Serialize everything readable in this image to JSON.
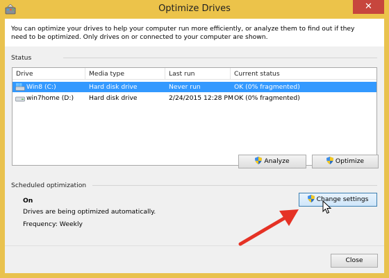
{
  "window": {
    "title": "Optimize Drives",
    "close_glyph": "✕"
  },
  "intro": {
    "text": "You can optimize your drives to help your computer run more efficiently, or analyze them to find out if they need to be optimized. Only drives on or connected to your computer are shown."
  },
  "status": {
    "label": "Status",
    "columns": [
      "Drive",
      "Media type",
      "Last run",
      "Current status"
    ],
    "rows": [
      {
        "drive": "Win8 (C:)",
        "media": "Hard disk drive",
        "last_run": "Never run",
        "status": "OK (0% fragmented)",
        "icon": "windows-drive-icon",
        "selected": true
      },
      {
        "drive": "win7home (D:)",
        "media": "Hard disk drive",
        "last_run": "2/24/2015 12:28 PM",
        "status": "OK (0% fragmented)",
        "icon": "hard-drive-icon",
        "selected": false
      }
    ],
    "analyze_label": "Analyze",
    "optimize_label": "Optimize"
  },
  "scheduled": {
    "label": "Scheduled optimization",
    "state": "On",
    "description": "Drives are being optimized automatically.",
    "frequency": "Frequency: Weekly",
    "change_settings_label": "Change settings"
  },
  "footer": {
    "close_label": "Close"
  },
  "colors": {
    "title_bar": "#ecc34a",
    "window_close": "#c7463d",
    "selection": "#3399ff",
    "annotation_arrow": "#e53225"
  },
  "icons": {
    "app": "optimize-drives-icon",
    "shield": "uac-shield-icon",
    "pointer": "mouse-cursor-icon",
    "annotation": "red-arrow-icon"
  }
}
